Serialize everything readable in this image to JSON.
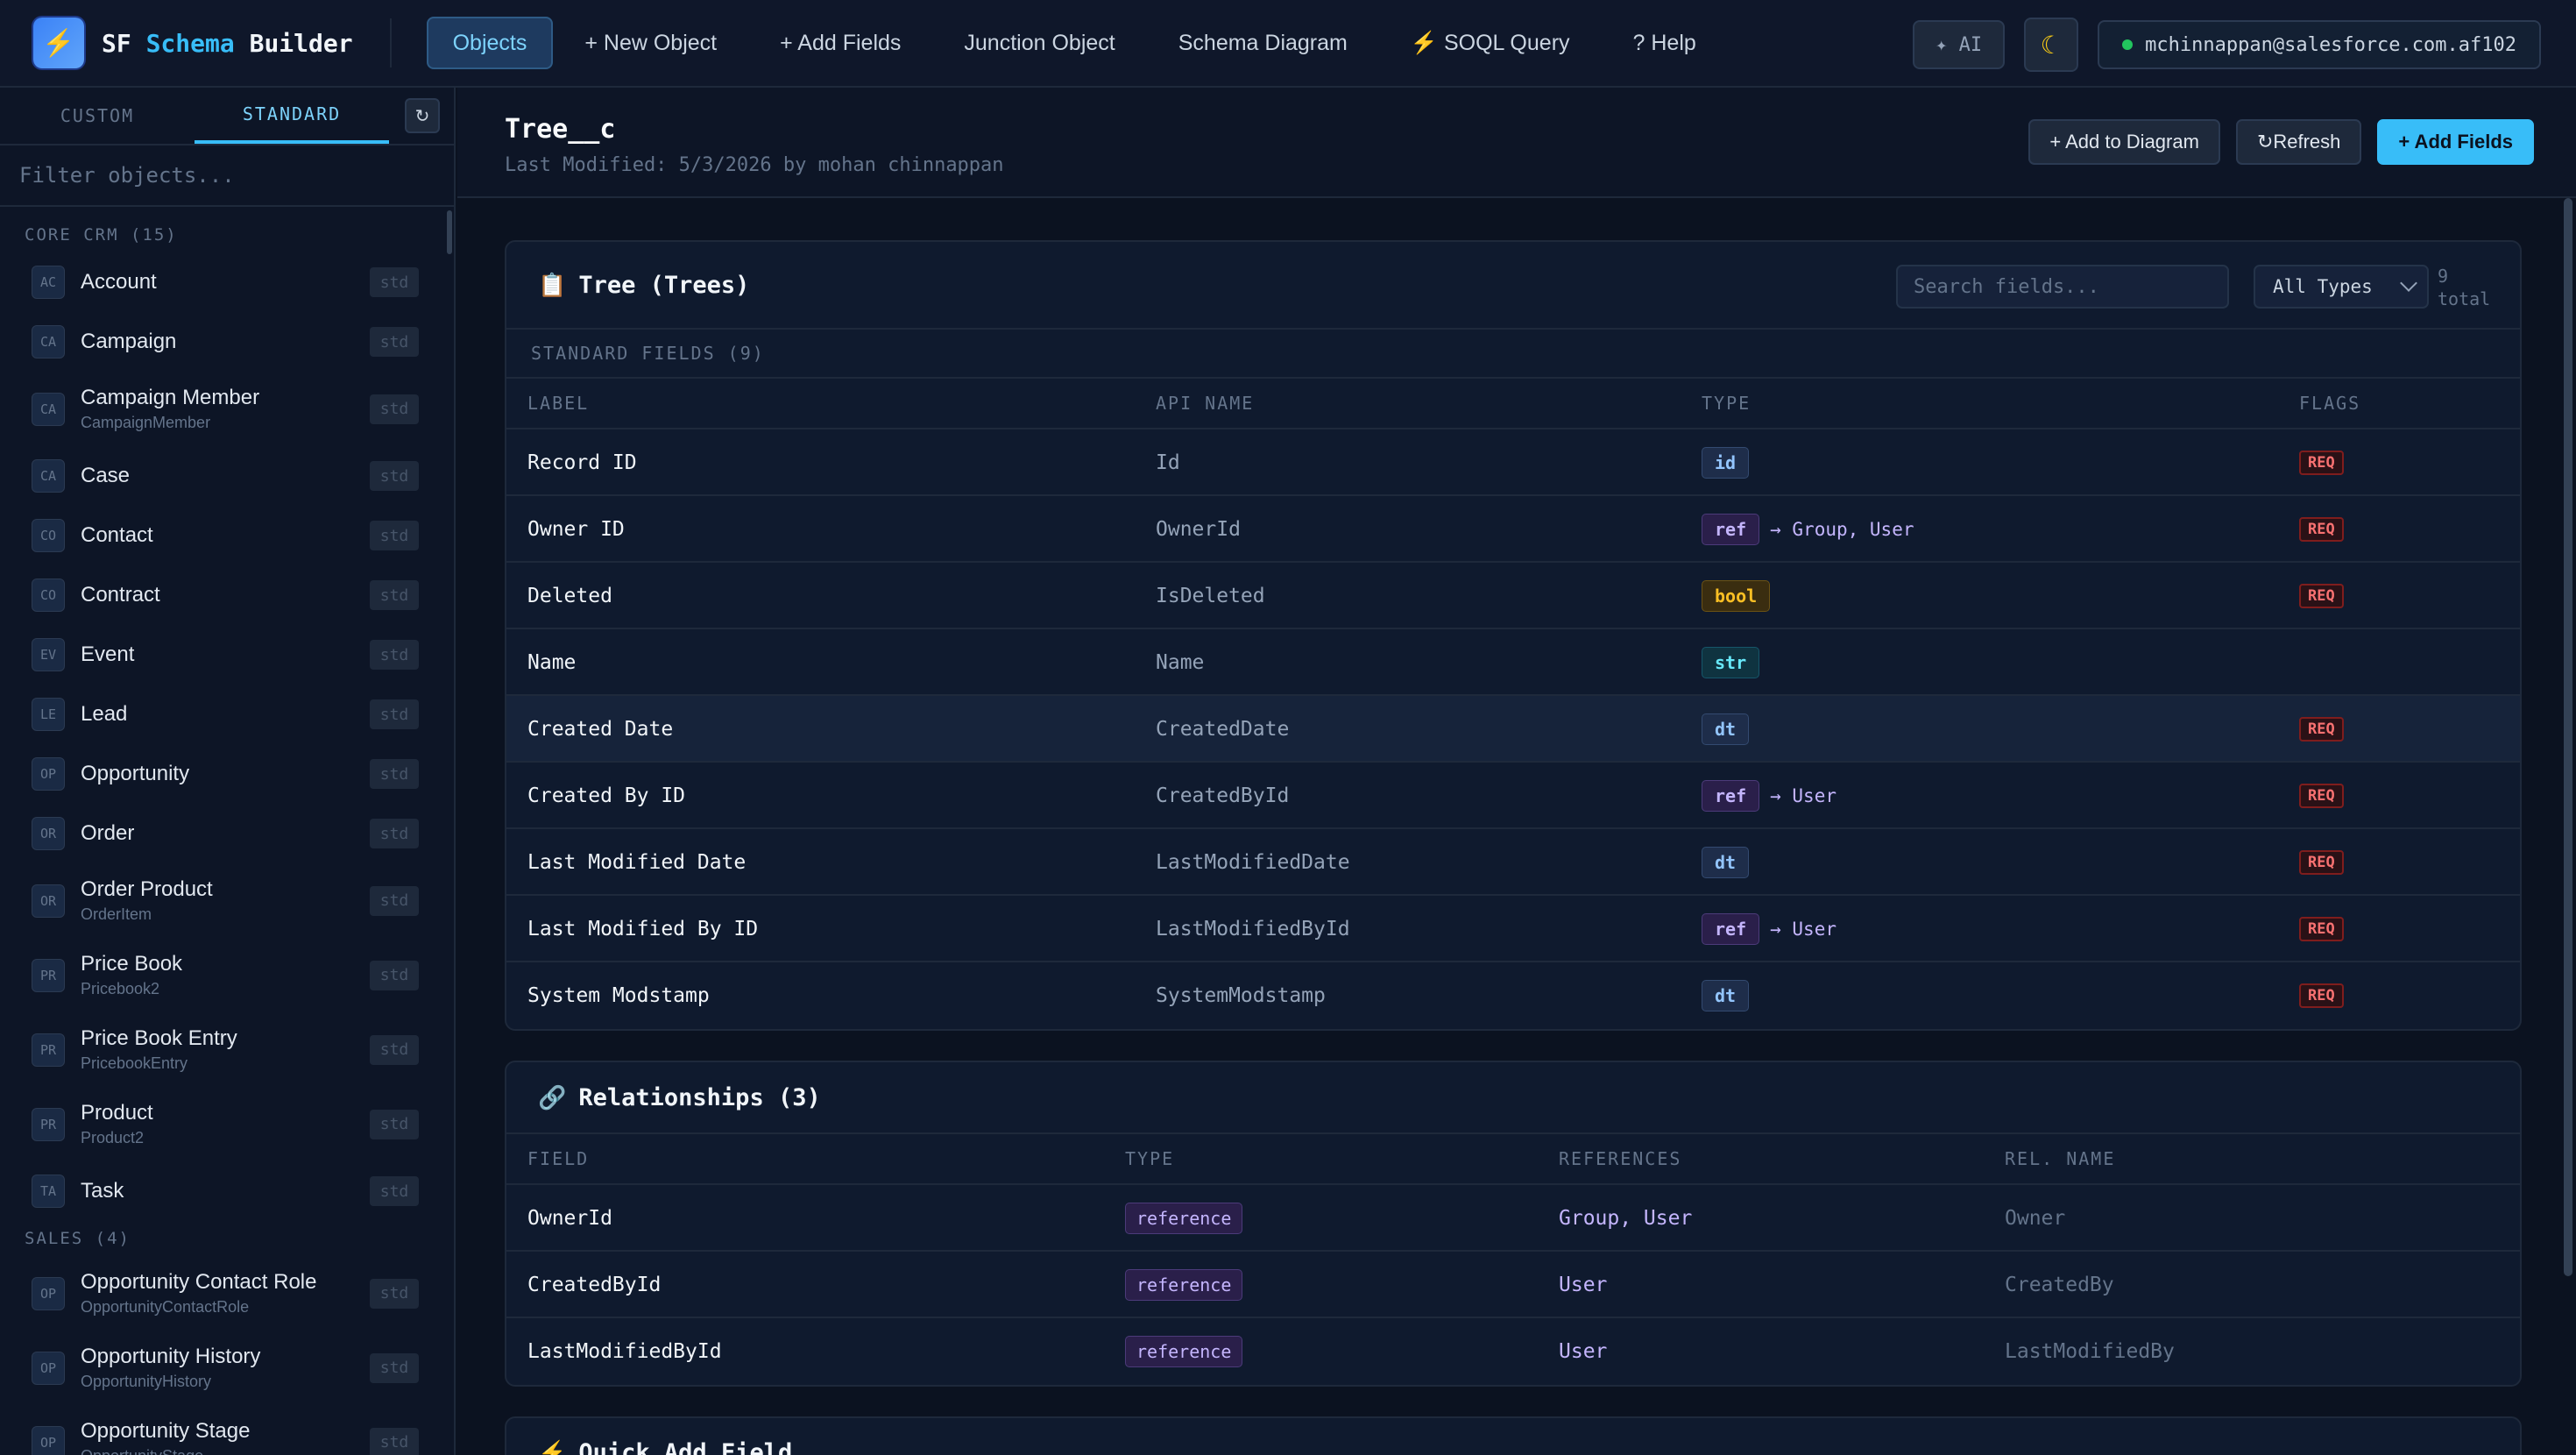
{
  "app": {
    "logo_glyph": "⚡",
    "brand_prefix": "SF ",
    "brand_accent": "Schema",
    "brand_suffix": " Builder"
  },
  "nav": {
    "items": [
      {
        "label": "Objects",
        "active": true
      },
      {
        "label": "+ New Object"
      },
      {
        "label": "+ Add Fields"
      },
      {
        "label": "Junction Object"
      },
      {
        "label": "Schema Diagram"
      },
      {
        "label": "⚡ SOQL Query"
      },
      {
        "label": "? Help"
      }
    ],
    "ai_label": "✦ AI",
    "theme_icon": "moon-icon",
    "user_email": "mchinnappan@salesforce.com.af102"
  },
  "sidebar": {
    "tabs": [
      "CUSTOM",
      "STANDARD"
    ],
    "active_tab": "STANDARD",
    "refresh_glyph": "↻",
    "filter_placeholder": "Filter objects...",
    "sections": [
      {
        "label": "CORE CRM (15)",
        "items": [
          {
            "badge": "AC",
            "name": "Account",
            "api": "",
            "chip": "std"
          },
          {
            "badge": "CA",
            "name": "Campaign",
            "api": "",
            "chip": "std"
          },
          {
            "badge": "CA",
            "name": "Campaign Member",
            "api": "CampaignMember",
            "chip": "std"
          },
          {
            "badge": "CA",
            "name": "Case",
            "api": "",
            "chip": "std"
          },
          {
            "badge": "CO",
            "name": "Contact",
            "api": "",
            "chip": "std"
          },
          {
            "badge": "CO",
            "name": "Contract",
            "api": "",
            "chip": "std"
          },
          {
            "badge": "EV",
            "name": "Event",
            "api": "",
            "chip": "std"
          },
          {
            "badge": "LE",
            "name": "Lead",
            "api": "",
            "chip": "std"
          },
          {
            "badge": "OP",
            "name": "Opportunity",
            "api": "",
            "chip": "std"
          },
          {
            "badge": "OR",
            "name": "Order",
            "api": "",
            "chip": "std"
          },
          {
            "badge": "OR",
            "name": "Order Product",
            "api": "OrderItem",
            "chip": "std"
          },
          {
            "badge": "PR",
            "name": "Price Book",
            "api": "Pricebook2",
            "chip": "std"
          },
          {
            "badge": "PR",
            "name": "Price Book Entry",
            "api": "PricebookEntry",
            "chip": "std"
          },
          {
            "badge": "PR",
            "name": "Product",
            "api": "Product2",
            "chip": "std"
          },
          {
            "badge": "TA",
            "name": "Task",
            "api": "",
            "chip": "std"
          }
        ]
      },
      {
        "label": "SALES (4)",
        "items": [
          {
            "badge": "OP",
            "name": "Opportunity Contact Role",
            "api": "OpportunityContactRole",
            "chip": "std"
          },
          {
            "badge": "OP",
            "name": "Opportunity History",
            "api": "OpportunityHistory",
            "chip": "std"
          },
          {
            "badge": "OP",
            "name": "Opportunity Stage",
            "api": "OpportunityStage",
            "chip": "std"
          }
        ]
      }
    ]
  },
  "object": {
    "title": "Tree__c",
    "modified": "Last Modified: 5/3/2026 by mohan chinnappan",
    "actions": {
      "add_to_diagram": "+ Add to Diagram",
      "refresh": "↻Refresh",
      "add_fields": "+ Add Fields"
    }
  },
  "fields_card": {
    "icon": "📋",
    "title": "Tree (Trees)",
    "search_placeholder": "Search fields...",
    "type_filter": "All Types",
    "total": "9 total",
    "sub_label": "STANDARD FIELDS (9)",
    "columns": [
      "LABEL",
      "API NAME",
      "TYPE",
      "FLAGS"
    ],
    "rows": [
      {
        "label": "Record ID",
        "api": "Id",
        "type": "id",
        "ref": "",
        "flag": "REQ"
      },
      {
        "label": "Owner ID",
        "api": "OwnerId",
        "type": "ref",
        "ref": "→ Group, User",
        "flag": "REQ"
      },
      {
        "label": "Deleted",
        "api": "IsDeleted",
        "type": "bool",
        "ref": "",
        "flag": "REQ"
      },
      {
        "label": "Name",
        "api": "Name",
        "type": "str",
        "ref": "",
        "flag": ""
      },
      {
        "label": "Created Date",
        "api": "CreatedDate",
        "type": "dt",
        "ref": "",
        "flag": "REQ",
        "highlight": true
      },
      {
        "label": "Created By ID",
        "api": "CreatedById",
        "type": "ref",
        "ref": "→ User",
        "flag": "REQ"
      },
      {
        "label": "Last Modified Date",
        "api": "LastModifiedDate",
        "type": "dt",
        "ref": "",
        "flag": "REQ"
      },
      {
        "label": "Last Modified By ID",
        "api": "LastModifiedById",
        "type": "ref",
        "ref": "→ User",
        "flag": "REQ"
      },
      {
        "label": "System Modstamp",
        "api": "SystemModstamp",
        "type": "dt",
        "ref": "",
        "flag": "REQ"
      }
    ]
  },
  "rel_card": {
    "icon": "🔗",
    "title": "Relationships (3)",
    "columns": [
      "FIELD",
      "TYPE",
      "REFERENCES",
      "REL. NAME"
    ],
    "rows": [
      {
        "field": "OwnerId",
        "type": "reference",
        "refs": "Group, User",
        "rel": "Owner"
      },
      {
        "field": "CreatedById",
        "type": "reference",
        "refs": "User",
        "rel": "CreatedBy"
      },
      {
        "field": "LastModifiedById",
        "type": "reference",
        "refs": "User",
        "rel": "LastModifiedBy"
      }
    ]
  },
  "quick_card": {
    "icon": "⚡",
    "title": "Quick Add Field"
  }
}
